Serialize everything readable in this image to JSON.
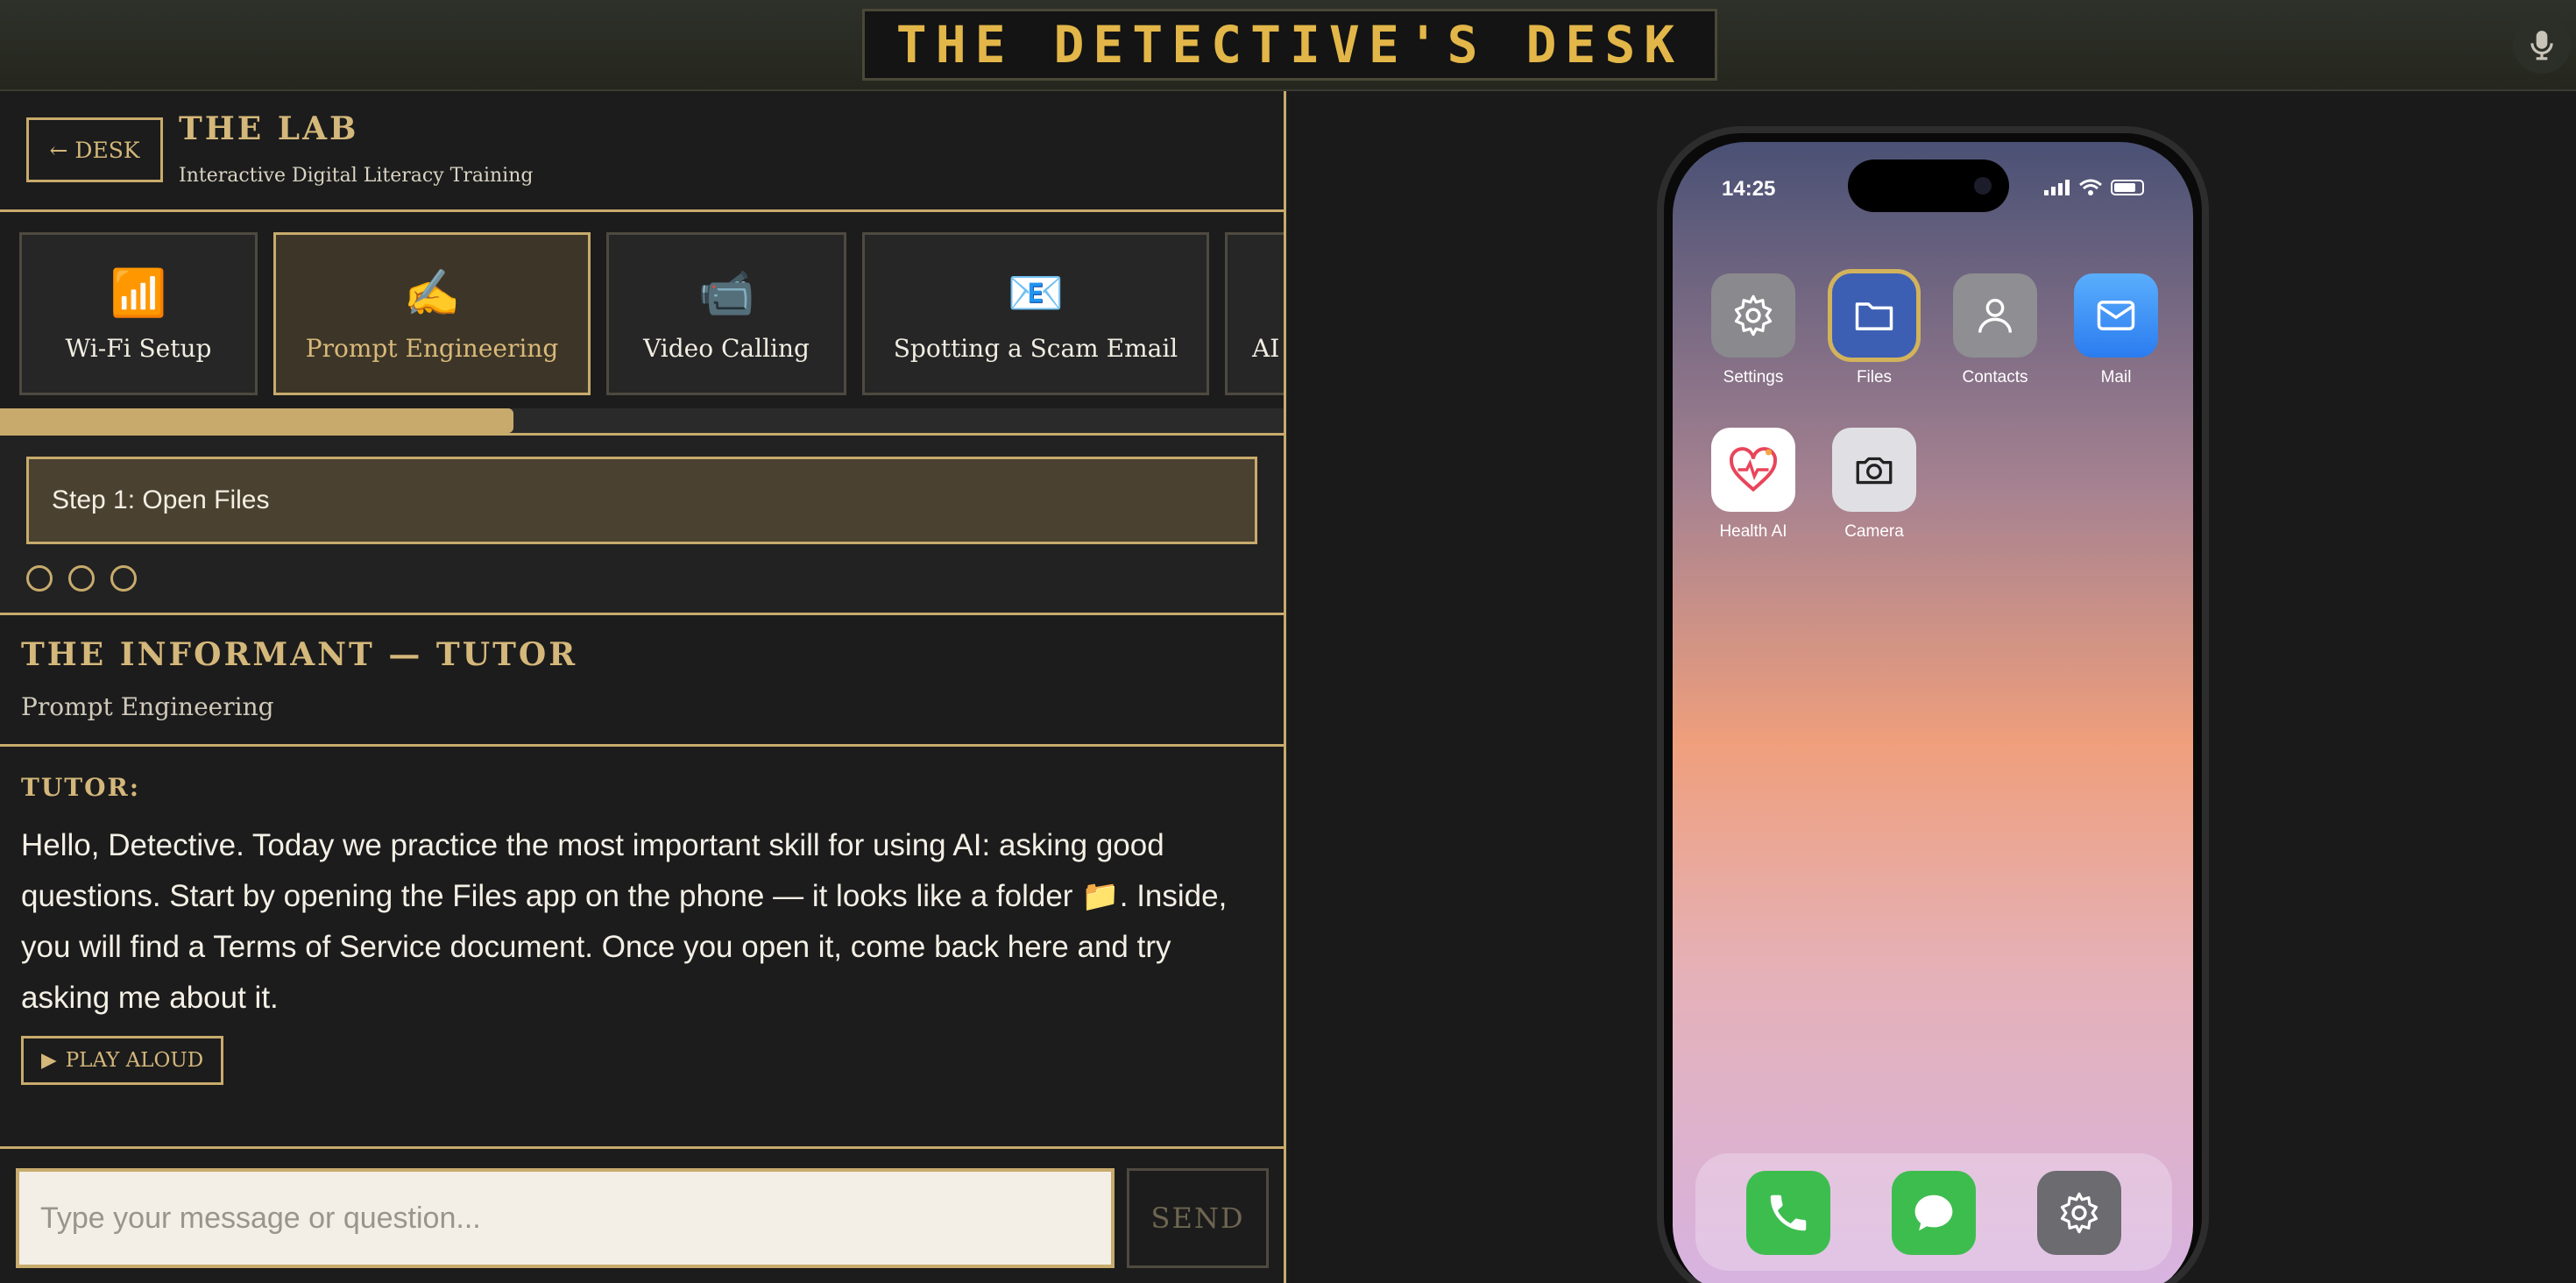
{
  "app": {
    "title": "THE DETECTIVE'S DESK",
    "mic_icon": "microphone-icon"
  },
  "header": {
    "back_label": "← DESK",
    "title": "THE LAB",
    "subtitle": "Interactive Digital Literacy Training"
  },
  "modules": [
    {
      "label": "Wi-Fi Setup",
      "icon": "📶"
    },
    {
      "label": "Prompt Engineering",
      "icon": "✍️"
    },
    {
      "label": "Video Calling",
      "icon": "📹"
    },
    {
      "label": "Spotting a Scam Email",
      "icon": "📧"
    },
    {
      "label": "AI",
      "icon": ""
    }
  ],
  "active_module_index": 1,
  "progress_fraction": 0.4,
  "step": {
    "label": "Step 1: Open Files",
    "total_steps": 3
  },
  "tutor": {
    "title": "THE INFORMANT — TUTOR",
    "subtitle": "Prompt Engineering"
  },
  "message": {
    "sender": "TUTOR:",
    "text": "Hello, Detective. Today we practice the most important skill for using AI: asking good questions. Start by opening the Files app on the phone — it looks like a folder 📁. Inside, you will find a Terms of Service document. Once you open it, come back here and try asking me about it.",
    "play_label": "PLAY ALOUD"
  },
  "composer": {
    "placeholder": "Type your message or question...",
    "send_label": "SEND"
  },
  "phone": {
    "time": "14:25",
    "apps": [
      {
        "label": "Settings",
        "icon": "gear-icon",
        "color": "#8a8a8e",
        "selected": false
      },
      {
        "label": "Files",
        "icon": "folder-icon",
        "color": "#3d5fb3",
        "selected": true
      },
      {
        "label": "Contacts",
        "icon": "person-icon",
        "color": "#8e8e93",
        "selected": false
      },
      {
        "label": "Mail",
        "icon": "mail-icon",
        "color": "#3a8cf3",
        "selected": false
      },
      {
        "label": "Health AI",
        "icon": "heart-icon",
        "color": "#ffffff",
        "selected": false
      },
      {
        "label": "Camera",
        "icon": "camera-icon",
        "color": "#e0e0e4",
        "selected": false
      }
    ],
    "dock": [
      {
        "icon": "phone-icon",
        "color": "#3ebd4f"
      },
      {
        "icon": "message-icon",
        "color": "#3ebd4f"
      },
      {
        "icon": "gear-icon",
        "color": "#6b6b70"
      }
    ]
  }
}
